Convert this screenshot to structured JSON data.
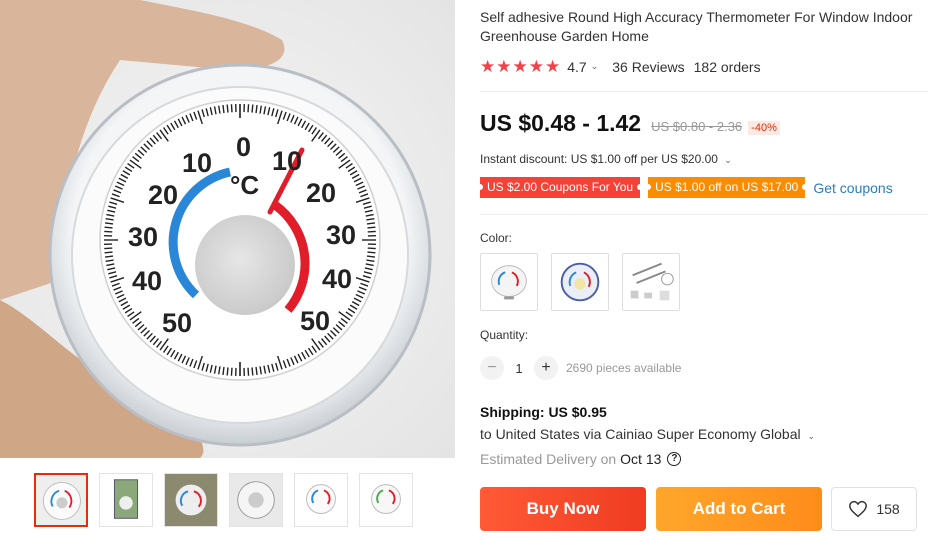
{
  "product": {
    "title": "Self adhesive Round High Accuracy Thermometer For Window Indoor Greenhouse Garden Home",
    "rating": "4.7",
    "reviews": "36 Reviews",
    "orders": "182 orders"
  },
  "price": {
    "current": "US $0.48 - 1.42",
    "original": "US $0.80 - 2.36",
    "discount": "-40%"
  },
  "promo": {
    "instant_discount": "Instant discount: US $1.00 off per US $20.00",
    "coupon_1": "US $2.00 Coupons For You",
    "coupon_2": "US $1.00 off on US $17.00",
    "get_coupons": "Get coupons"
  },
  "color": {
    "label": "Color:"
  },
  "quantity": {
    "label": "Quantity:",
    "minus": "−",
    "value": "1",
    "plus": "+",
    "available": "2690 pieces available"
  },
  "shipping": {
    "label": "Shipping:",
    "cost": "US $0.95",
    "route": "to United States via Cainiao Super Economy Global",
    "delivery_label": "Estimated Delivery on",
    "delivery_date": "Oct 13"
  },
  "actions": {
    "buy_now": "Buy Now",
    "add_to_cart": "Add to Cart",
    "wishlist_count": "158"
  },
  "dial": {
    "unit": "°C",
    "left_labels": [
      "10",
      "20",
      "30",
      "40",
      "50"
    ],
    "right_labels": [
      "10",
      "20",
      "30",
      "40",
      "50"
    ],
    "zero_label": "0"
  },
  "colors": {
    "star": "#f4414a",
    "buy_now": "#f44336",
    "add_to_cart": "#ff9f1a",
    "link": "#2e7bbf",
    "cold_arc": "#2a86d6",
    "hot_arc": "#e21d2a"
  }
}
